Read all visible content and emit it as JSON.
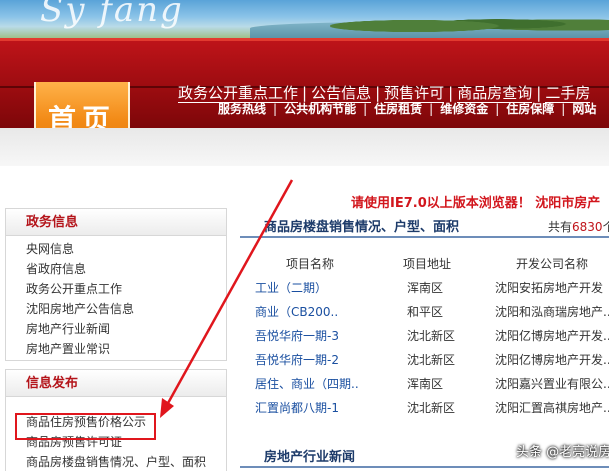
{
  "nav": {
    "home_label": "首页",
    "top_links": [
      "政务公开重点工作",
      "公告信息",
      "预售许可",
      "商品房查询",
      "二手房"
    ],
    "sub_links": [
      "服务热线",
      "公共机构节能",
      "住房租赁",
      "维修资金",
      "住房保障",
      "网站"
    ]
  },
  "notice": "请使用IE7.0以上版本浏览器！ 沈阳市房产",
  "sidebar": {
    "box1": {
      "title": "政务信息",
      "items": [
        "央网信息",
        "省政府信息",
        "政务公开重点工作",
        "沈阳房地产公告信息",
        "房地产行业新闻",
        "房地产置业常识"
      ]
    },
    "box2": {
      "title": "信息发布",
      "items": [
        "商品住房预售价格公示",
        "商品房预售许可证",
        "商品房楼盘销售情况、户型、面积"
      ]
    }
  },
  "main": {
    "section1": {
      "title": "商品房楼盘销售情况、户型、面积",
      "count_prefix": "共有",
      "count_value": "6830",
      "count_suffix": "个"
    },
    "table": {
      "headers": [
        "项目名称",
        "项目地址",
        "开发公司名称"
      ],
      "rows": [
        [
          "工业（二期）",
          "浑南区",
          "沈阳安拓房地产开发"
        ],
        [
          "商业（CB200..",
          "和平区",
          "沈阳和泓商瑞房地产..."
        ],
        [
          "吾悦华府一期-3",
          "沈北新区",
          "沈阳亿博房地产开发..."
        ],
        [
          "吾悦华府一期-2",
          "沈北新区",
          "沈阳亿博房地产开发..."
        ],
        [
          "居住、商业（四期..",
          "浑南区",
          "沈阳嘉兴置业有限公..."
        ],
        [
          "汇置尚都八期-1",
          "沈北新区",
          "沈阳汇置高祺房地产..."
        ]
      ]
    },
    "section2": {
      "title": "房地产行业新闻"
    }
  },
  "watermark": "头条 @老亮说房",
  "colors": {
    "nav_red": "#9c0c10",
    "home_orange": "#f28a16",
    "accent_red": "#d2161d",
    "link_blue": "#1a4fa0",
    "rule_blue": "#6d8db9"
  }
}
